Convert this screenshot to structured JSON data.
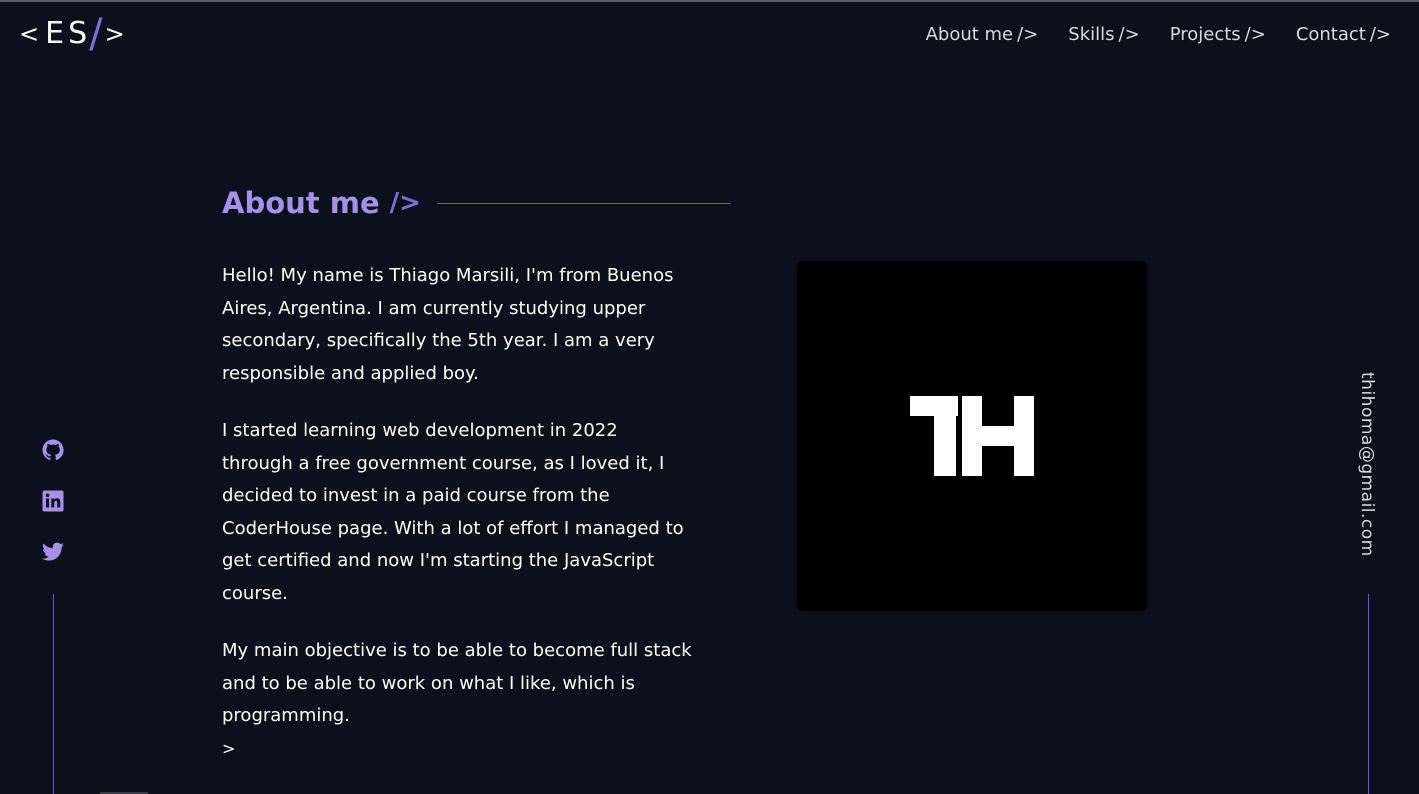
{
  "logo": {
    "open": "<",
    "letters": "ES",
    "slash": "/",
    "close": ">"
  },
  "nav": {
    "items": [
      {
        "label": "About me",
        "suffix": "/>"
      },
      {
        "label": "Skills",
        "suffix": "/>"
      },
      {
        "label": "Projects",
        "suffix": "/>"
      },
      {
        "label": "Contact",
        "suffix": "/>"
      }
    ]
  },
  "about": {
    "title": "About me",
    "title_suffix": "/>",
    "paragraphs": [
      "Hello! My name is Thiago Marsili, I'm from Buenos Aires, Argentina. I am currently studying upper secondary, specifically the 5th year. I am a very responsible and applied boy.",
      "I started learning web development in 2022 through a free government course, as I loved it, I decided to invest in a paid course from the CoderHouse page. With a lot of effort I managed to get certified and now I'm starting the JavaScript course.",
      "My main objective is to be able to become full stack and to be able to work on what I like, which is programming."
    ],
    "trailing_chevron": ">"
  },
  "profile": {
    "monogram": "TH"
  },
  "social": {
    "icons": [
      "github-icon",
      "linkedin-icon",
      "twitter-icon"
    ],
    "color": "#a592e8"
  },
  "contact": {
    "email": "thihoma@gmail.com"
  },
  "colors": {
    "background": "#0c101d",
    "accent": "#a592e8",
    "accent_dark": "#6a55d0",
    "text": "#ffffff",
    "nav_text": "#d9d9e0"
  }
}
